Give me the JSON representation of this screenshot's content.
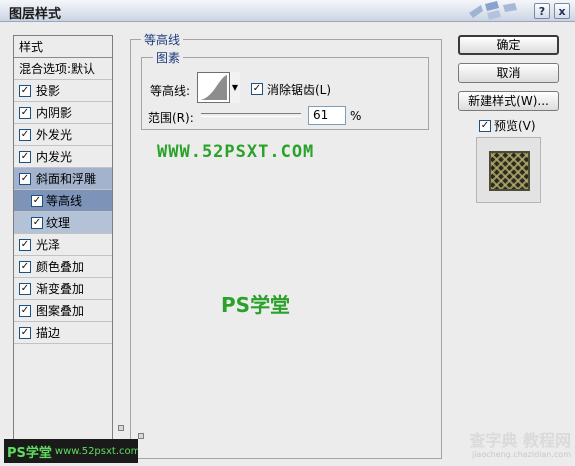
{
  "window": {
    "title": "图层样式",
    "help_glyph": "?",
    "close_glyph": "x"
  },
  "style_list": {
    "header": "样式",
    "blend_options": "混合选项:默认",
    "items": [
      {
        "label": "投影",
        "checked": true
      },
      {
        "label": "内阴影",
        "checked": true
      },
      {
        "label": "外发光",
        "checked": true
      },
      {
        "label": "内发光",
        "checked": true
      },
      {
        "label": "斜面和浮雕",
        "checked": true
      },
      {
        "label": "等高线",
        "checked": true
      },
      {
        "label": "纹理",
        "checked": true
      },
      {
        "label": "光泽",
        "checked": true
      },
      {
        "label": "颜色叠加",
        "checked": true
      },
      {
        "label": "渐变叠加",
        "checked": true
      },
      {
        "label": "图案叠加",
        "checked": true
      },
      {
        "label": "描边",
        "checked": true
      }
    ],
    "check_glyph": "✓"
  },
  "contour_panel": {
    "group_title": "等高线",
    "subgroup_title": "图素",
    "contour_label": "等高线:",
    "anti_alias_label": "消除锯齿(L)",
    "anti_alias_checked": true,
    "range_label": "范围(R):",
    "range_value": "61",
    "range_unit": "%",
    "dropdown_arrow": "▼"
  },
  "buttons": {
    "ok": "确定",
    "cancel": "取消",
    "new_style": "新建样式(W)...",
    "preview_label": "预览(V)",
    "preview_checked": true
  },
  "watermarks": {
    "site": "WWW.52PSXT.COM",
    "ps_text": "PS学堂",
    "corner_big": "PS学堂",
    "corner_small": "www.52psxt.com",
    "jiaocheng_big": "查字典 教程网",
    "jiaocheng_small": "jiaocheng.chazidian.com"
  },
  "colors": {
    "selected_row": "#a3b3cd",
    "active_row": "#7d93b8",
    "legend_text": "#1c3c7c",
    "watermark_green": "#2aa22a"
  }
}
